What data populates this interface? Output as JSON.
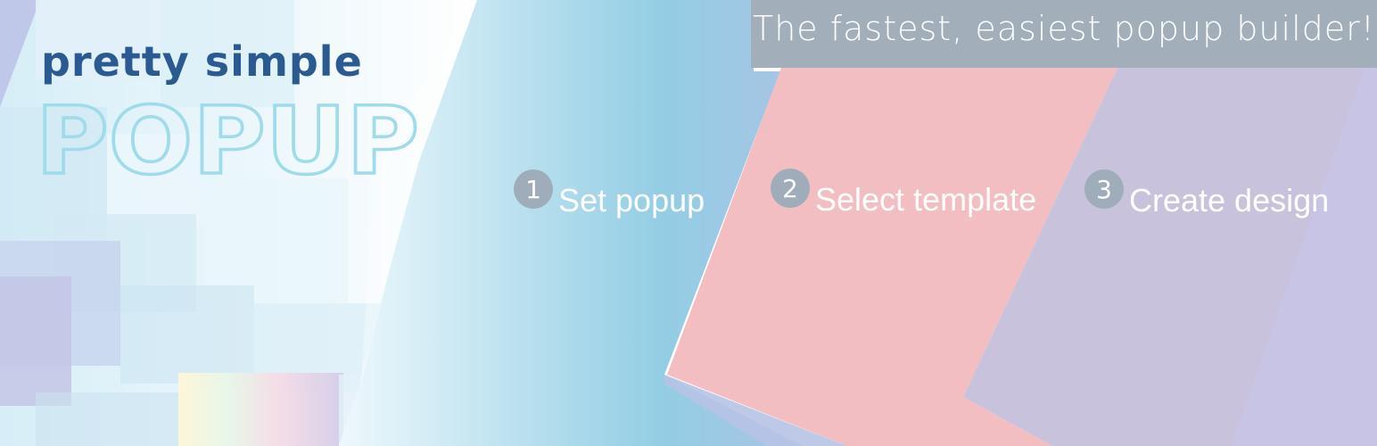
{
  "banner": {
    "tagline": "The fastest, easiest popup builder!",
    "logo": {
      "small_text": "pretty simple",
      "big_text": "POPUP"
    },
    "steps": [
      {
        "number": "1",
        "label": "Set popup"
      },
      {
        "number": "2",
        "label": "Select template"
      },
      {
        "number": "3",
        "label": "Create design"
      }
    ]
  },
  "colors": {
    "tagline_bar": "#a2aeba",
    "logo_blue": "#2a5a91",
    "logo_outline": "#9fdbea",
    "blue_panel": "#93cde4",
    "pink_panel": "#f3bec1",
    "purple_panel": "#c9c2dd",
    "step_circle": "#9eadb9"
  }
}
